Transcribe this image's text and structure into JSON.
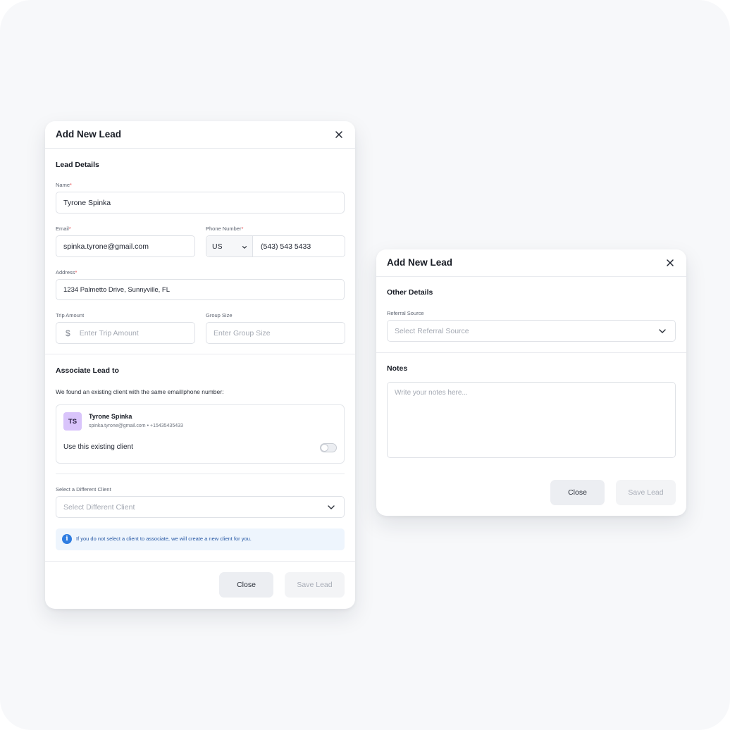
{
  "lead_form": {
    "title": "Add New Lead",
    "lead_details": {
      "section_title": "Lead Details",
      "name": {
        "label": "Name",
        "required_mark": "*",
        "value": "Tyrone Spinka"
      },
      "email": {
        "label": "Email",
        "required_mark": "*",
        "value": "spinka.tyrone@gmail.com"
      },
      "phone": {
        "label": "Phone Number",
        "required_mark": "*",
        "country": "US",
        "value": "(543) 543 5433"
      },
      "address": {
        "label": "Address",
        "required_mark": "*",
        "value": "1234 Palmetto Drive, Sunnyville, FL"
      },
      "trip_amount": {
        "label": "Trip Amount",
        "currency_symbol": "$",
        "placeholder": "Enter Trip Amount"
      },
      "group_size": {
        "label": "Group Size",
        "placeholder": "Enter Group Size"
      }
    },
    "associate": {
      "section_title": "Associate Lead to",
      "found_text": "We found an existing client with the same email/phone number:",
      "client": {
        "initials": "TS",
        "avatar_color": "#d9c4fb",
        "name": "Tyrone Spinka",
        "contact": "spinka.tyrone@gmail.com • +15435435433"
      },
      "use_existing_label": "Use this existing client",
      "use_existing_enabled": false,
      "different_client": {
        "label": "Select a Different Client",
        "placeholder": "Select Different Client"
      },
      "info_text": "If you do not select a client to associate, we will create a new client for you."
    },
    "buttons": {
      "close": "Close",
      "save": "Save Lead"
    }
  },
  "other_form": {
    "title": "Add New Lead",
    "other_details": {
      "section_title": "Other Details",
      "referral": {
        "label": "Referral Source",
        "placeholder": "Select Referral Source"
      }
    },
    "notes": {
      "section_title": "Notes",
      "placeholder": "Write your notes here..."
    },
    "buttons": {
      "close": "Close",
      "save": "Save Lead"
    }
  },
  "colors": {
    "required": "#e5484d",
    "info_accent": "#2f7de1",
    "info_background": "#eef5fd"
  },
  "icons": [
    "close-icon",
    "chevron-down-icon",
    "info-icon",
    "dollar-icon"
  ]
}
